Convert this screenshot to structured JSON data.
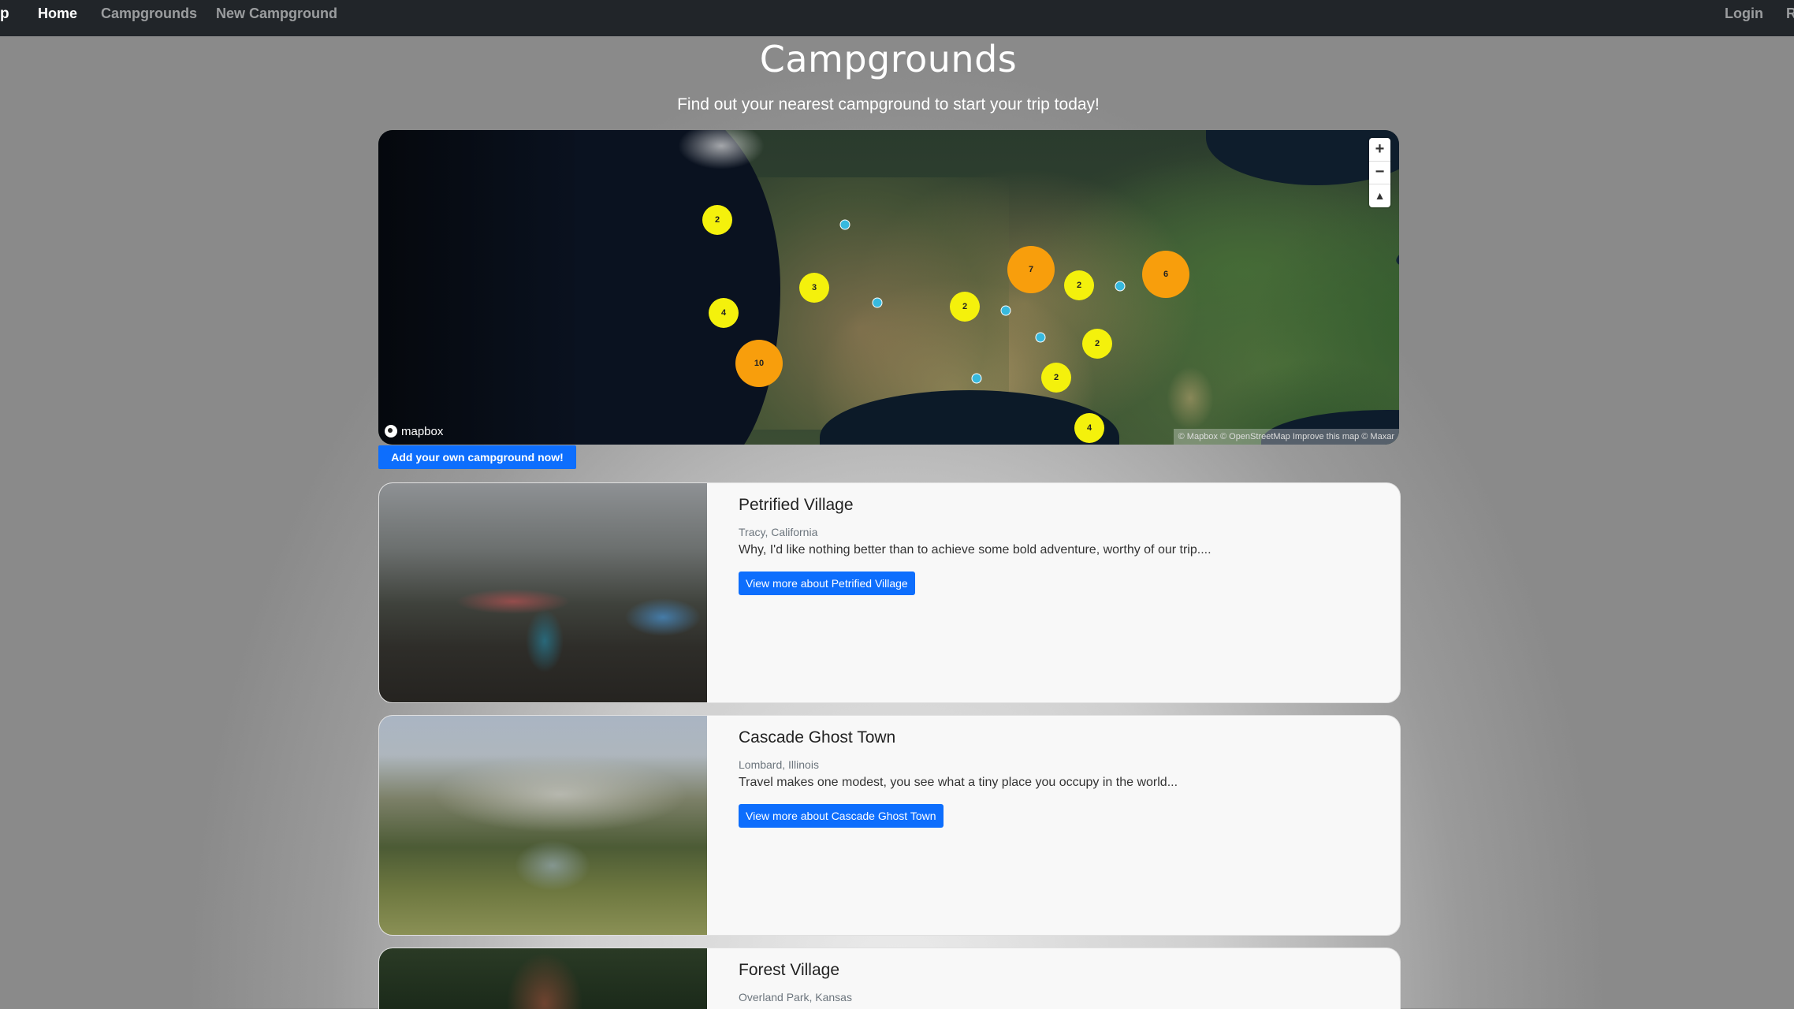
{
  "navbar": {
    "brand_fragment": "p",
    "links": [
      {
        "label": "Home",
        "active": true
      },
      {
        "label": "Campgrounds",
        "active": false
      },
      {
        "label": "New Campground",
        "active": false
      }
    ],
    "right_links": [
      {
        "label": "Login"
      },
      {
        "label": "R"
      }
    ]
  },
  "header": {
    "title": "Campgrounds",
    "subtitle": "Find out your nearest campground to start your trip today!"
  },
  "map": {
    "clusters": [
      {
        "count": "2",
        "size": "small"
      },
      {
        "count": "3",
        "size": "small"
      },
      {
        "count": "4",
        "size": "small"
      },
      {
        "count": "10",
        "size": "big"
      },
      {
        "count": "7",
        "size": "big"
      },
      {
        "count": "2",
        "size": "small"
      },
      {
        "count": "6",
        "size": "big"
      },
      {
        "count": "2",
        "size": "small"
      },
      {
        "count": "2",
        "size": "small"
      },
      {
        "count": "2",
        "size": "small"
      },
      {
        "count": "4",
        "size": "small"
      }
    ],
    "controls": {
      "zoom_in": "+",
      "zoom_out": "−",
      "compass": "▲"
    },
    "logo_text": "mapbox",
    "attribution": "© Mapbox © OpenStreetMap Improve this map © Maxar",
    "colors": {
      "cluster_small": "#f4f10c",
      "cluster_big": "#f89e0c",
      "point": "#37b9de"
    }
  },
  "add_button": {
    "label": "Add your own campground now!"
  },
  "campgrounds": [
    {
      "title": "Petrified Village",
      "location": "Tracy, California",
      "description": "Why, I'd like nothing better than to achieve some bold adventure, worthy of our trip....",
      "button_label": "View more about Petrified Village"
    },
    {
      "title": "Cascade Ghost Town",
      "location": "Lombard, Illinois",
      "description": "Travel makes one modest, you see what a tiny place you occupy in the world...",
      "button_label": "View more about Cascade Ghost Town"
    },
    {
      "title": "Forest Village",
      "location": "Overland Park, Kansas",
      "description": "",
      "button_label": ""
    }
  ],
  "accent_color": "#0d6efd"
}
